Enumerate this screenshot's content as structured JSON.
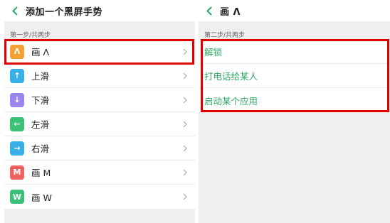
{
  "left": {
    "title": "添加一个黑屏手势",
    "section": "第一步/共两步",
    "gestures": [
      {
        "label": "画 Λ",
        "glyph": "Λ",
        "color": "#f5a033",
        "icon": "caret-up-icon"
      },
      {
        "label": "上滑",
        "glyph": "↑",
        "color": "#37b0e8",
        "icon": "arrow-up-icon"
      },
      {
        "label": "下滑",
        "glyph": "↓",
        "color": "#9a86ee",
        "icon": "arrow-down-icon"
      },
      {
        "label": "左滑",
        "glyph": "←",
        "color": "#3cbf77",
        "icon": "arrow-left-icon"
      },
      {
        "label": "右滑",
        "glyph": "→",
        "color": "#37b0e8",
        "icon": "arrow-right-icon"
      },
      {
        "label": "画 M",
        "glyph": "M",
        "color": "#ef6060",
        "icon": "letter-m-icon"
      },
      {
        "label": "画 W",
        "glyph": "W",
        "color": "#3cbf77",
        "icon": "letter-w-icon"
      }
    ]
  },
  "right": {
    "title": "画 Λ",
    "section": "第二步/共两步",
    "actions": [
      {
        "label": "解锁"
      },
      {
        "label": "打电话给某人"
      },
      {
        "label": "启动某个应用"
      }
    ]
  },
  "colors": {
    "accent": "#2ea866",
    "highlight": "#e00000",
    "background": "#efefef"
  }
}
